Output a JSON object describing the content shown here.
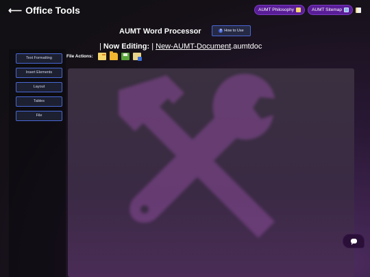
{
  "header": {
    "back_arrow": "⟵",
    "title": "Office Tools",
    "links": [
      {
        "label": "AUMT Philosophy",
        "icon": "scroll-icon"
      },
      {
        "label": "AUMT Sitemap",
        "icon": "map-icon"
      }
    ],
    "extra_icon": "memo-icon"
  },
  "app": {
    "title": "AUMT Word Processor",
    "how_to_use": "How to Use"
  },
  "editing": {
    "prefix": "| ",
    "label": "Now Editing:",
    "separator": " | ",
    "doc_name": "New-AUMT-Document",
    "extension": ".aumtdoc"
  },
  "file_actions": {
    "label": "File Actions:",
    "buttons": [
      "new-file-icon",
      "open-folder-icon",
      "save-icon",
      "export-icon"
    ]
  },
  "sidebar": {
    "items": [
      {
        "label": "Text Formatting"
      },
      {
        "label": "Insert Elements"
      },
      {
        "label": "Layout"
      },
      {
        "label": "Tables"
      },
      {
        "label": "File"
      }
    ]
  },
  "colors": {
    "accent_border": "#4a68d8",
    "pill_bg": "#5a1d98",
    "editor_bg": "#3a3040",
    "chat_bg": "#2a0f38"
  }
}
